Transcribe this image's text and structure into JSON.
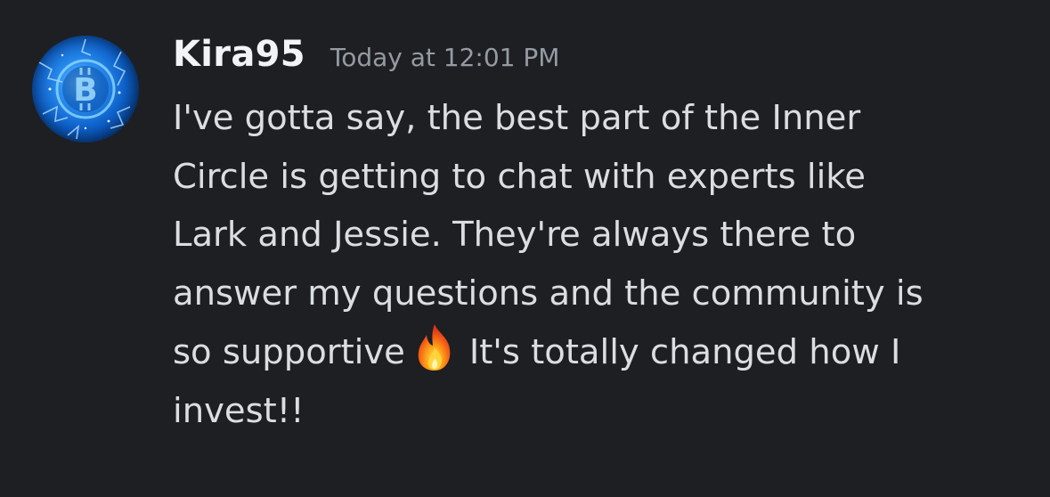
{
  "message": {
    "author": "Kira95",
    "timestamp": "Today at 12:01 PM",
    "avatar_icon": "bitcoin-avatar-icon",
    "lines": [
      "I've gotta say, the best part of the Inner",
      "Circle is getting to chat with experts like",
      "Lark and Jessie. They're always there to",
      "answer my questions and the community is",
      "so supportive",
      "It's totally changed how I",
      "invest!!"
    ],
    "emoji": "fire-emoji"
  },
  "colors": {
    "background": "#1e1f22",
    "username": "#f2f3f5",
    "timestamp": "#949ba4",
    "text": "#dbdee1"
  }
}
